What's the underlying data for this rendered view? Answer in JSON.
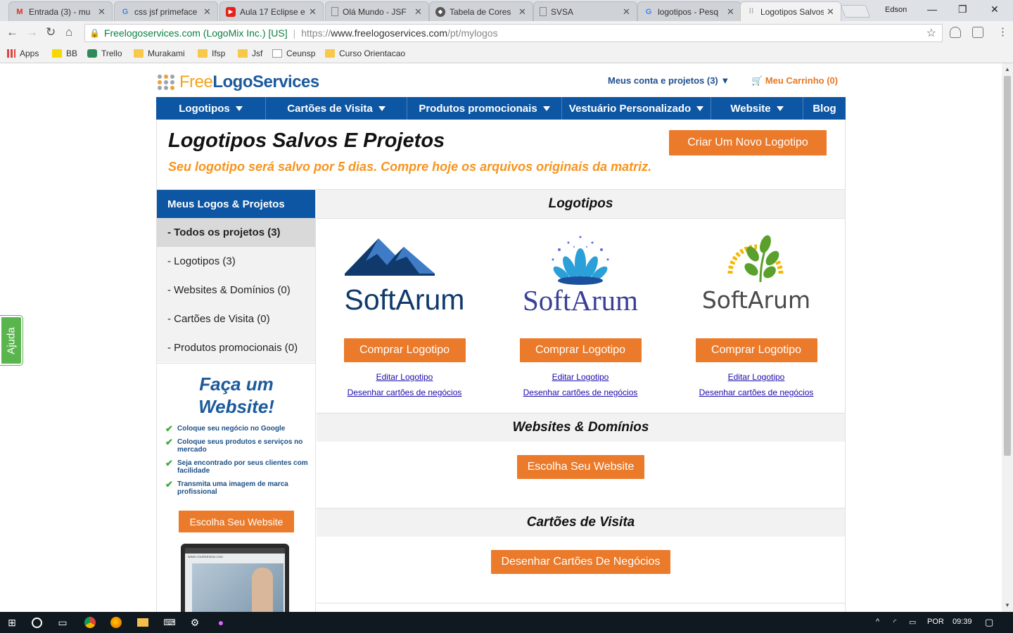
{
  "browser": {
    "tabs": [
      {
        "title": "Entrada (3) - mu",
        "icon": "gmail-icon"
      },
      {
        "title": "css jsf primeface",
        "icon": "google-icon"
      },
      {
        "title": "Aula 17 Eclipse e",
        "icon": "youtube-icon"
      },
      {
        "title": "Olá Mundo - JSF",
        "icon": "page-icon"
      },
      {
        "title": "Tabela de Cores",
        "icon": "globe-icon"
      },
      {
        "title": "SVSA",
        "icon": "page-icon"
      },
      {
        "title": "logotipos - Pesq",
        "icon": "google-icon"
      },
      {
        "title": "Logotipos Salvos",
        "icon": "grid-icon"
      }
    ],
    "user": "Edson",
    "site_identity": "Freelogoservices.com (LogoMix Inc.) [US]",
    "url_scheme": "https://",
    "url_host": "www.freelogoservices.com",
    "url_path": "/pt/mylogos",
    "bookmarks": [
      "Apps",
      "BB",
      "Trello",
      "Murakami",
      "Ifsp",
      "Jsf",
      "Ceunsp",
      "Curso Orientacao"
    ]
  },
  "site": {
    "logo_free": "Free",
    "logo_rest": "LogoServices",
    "account": "Meus conta e projetos (3)",
    "cart": "Meu Carrinho (0)",
    "nav": [
      "Logotipos",
      "Cartões de Visita",
      "Produtos promocionais",
      "Vestuário Personalizado",
      "Website",
      "Blog"
    ]
  },
  "header": {
    "title": "Logotipos Salvos E Projetos",
    "subtitle": "Seu logotipo será salvo por 5 dias. Compre hoje os arquivos originais da matriz.",
    "new_logo_button": "Criar Um Novo Logotipo"
  },
  "sidebar": {
    "title": "Meus Logos & Projetos",
    "items": [
      "- Todos os projetos (3)",
      "- Logotipos (3)",
      "- Websites & Domínios (0)",
      "- Cartões de Visita (0)",
      "- Produtos promocionais (0)"
    ],
    "promo_title_1": "Faça um",
    "promo_title_2": "Website!",
    "promo_points": [
      "Coloque seu negócio no Google",
      "Coloque seus produtos e serviços no mercado",
      "Seja encontrado por seus clientes com facilidade",
      "Transmita uma imagem de marca profissional"
    ],
    "promo_button": "Escolha Seu Website",
    "laptop_url": "WWW.YOURDESIGN.COM"
  },
  "logos_section": {
    "title": "Logotipos",
    "items": [
      {
        "name": "SoftArum",
        "buy": "Comprar Logotipo",
        "edit": "Editar Logotipo",
        "cards": "Desenhar cartões de negócios",
        "color": "#0f3a6b"
      },
      {
        "name": "SoftArum",
        "buy": "Comprar Logotipo",
        "edit": "Editar Logotipo",
        "cards": "Desenhar cartões de negócios",
        "color": "#3b3f96"
      },
      {
        "name": "SoftArum",
        "buy": "Comprar Logotipo",
        "edit": "Editar Logotipo",
        "cards": "Desenhar cartões de negócios",
        "color": "#4a4a4a"
      }
    ]
  },
  "websites_section": {
    "title": "Websites & Domínios",
    "button": "Escolha Seu Website"
  },
  "cards_section": {
    "title": "Cartões de Visita",
    "button": "Desenhar Cartões De Negócios"
  },
  "help_tab": "Ajuda",
  "taskbar": {
    "lang": "POR",
    "time": "09:39"
  },
  "colors": {
    "brand_blue": "#0d56a4",
    "accent_orange": "#eb7a2a",
    "subtitle_orange": "#f7941d",
    "help_green": "#5bb54f"
  }
}
